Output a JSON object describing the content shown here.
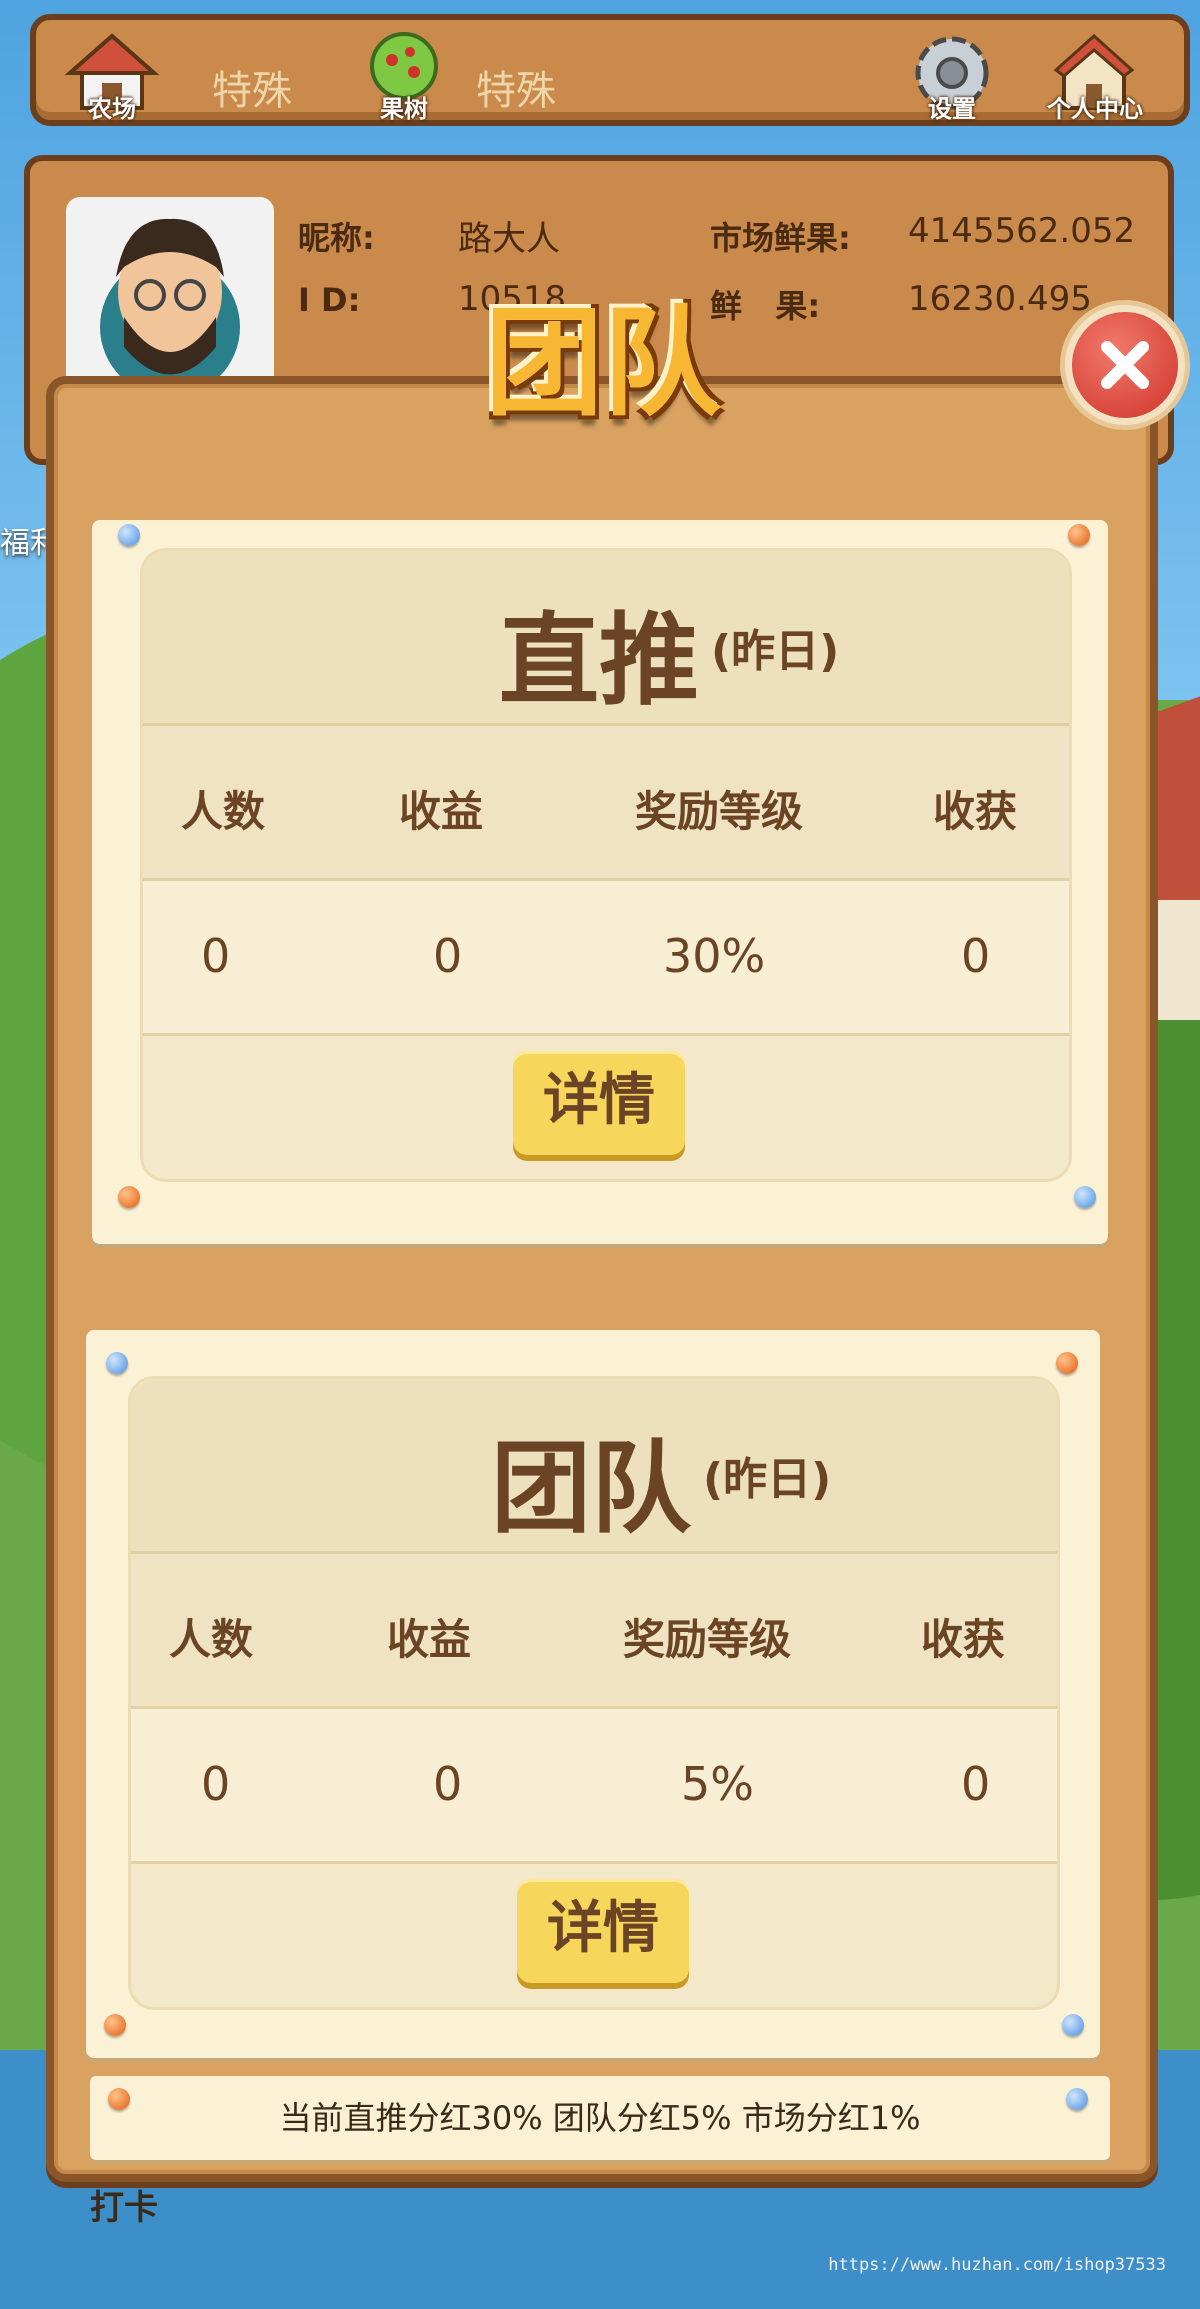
{
  "nav": {
    "farm_label": "农场",
    "farm_text": "特殊",
    "tree_label": "果树",
    "tree_text": "特殊",
    "settings_label": "设置",
    "profile_label": "个人中心"
  },
  "profile": {
    "nickname_label": "昵称:",
    "nickname": "路大人",
    "id_label": "I D:",
    "id_value": "10518",
    "market_label": "市场鲜果:",
    "market_value": "4145562.052",
    "fruit_label": "鲜   果:",
    "fruit_value": "16230.495"
  },
  "background": {
    "left_label": "福利",
    "bottom_label": "打卡",
    "watermark": "https://www.huzhan.com/ishop37533"
  },
  "modal": {
    "title": "团队",
    "direct": {
      "title": "直推",
      "sub": "(昨日)",
      "headers": [
        "人数",
        "收益",
        "奖励等级",
        "收获"
      ],
      "values": [
        "0",
        "0",
        "30%",
        "0"
      ],
      "button": "详情"
    },
    "team": {
      "title": "团队",
      "sub": "(昨日)",
      "headers": [
        "人数",
        "收益",
        "奖励等级",
        "收获"
      ],
      "values": [
        "0",
        "0",
        "5%",
        "0"
      ],
      "button": "详情"
    },
    "footer": "当前直推分红30% 团队分红5% 市场分红1%"
  },
  "colors": {
    "wood": "#d9a261",
    "paper": "#fbf2d5",
    "button_yellow": "#f7d65c",
    "text_brown": "#6b4425",
    "close_red": "#d0322a"
  }
}
